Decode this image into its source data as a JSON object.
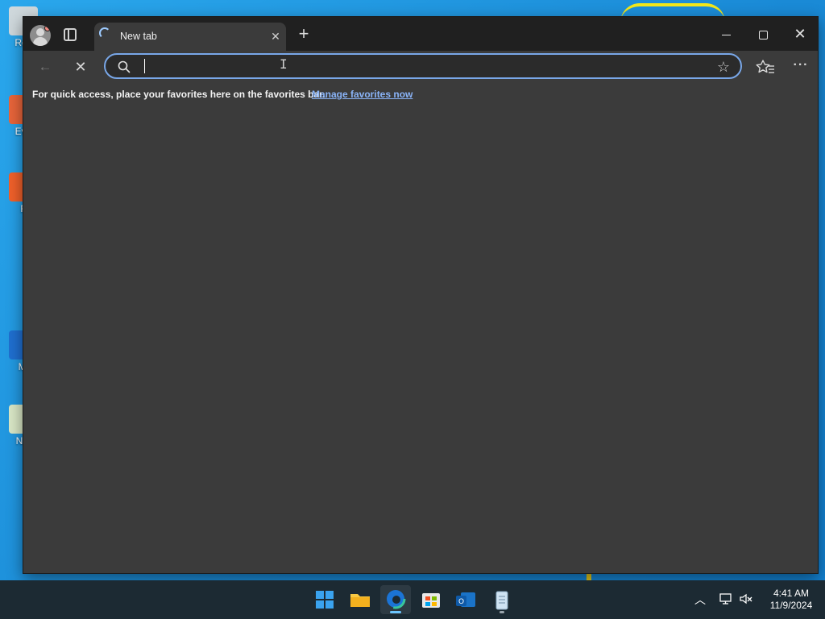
{
  "desktop": {
    "icons": [
      {
        "label": "Rec"
      },
      {
        "label": "Eve"
      },
      {
        "label": "F"
      },
      {
        "label": "Mi"
      },
      {
        "label": "Not"
      }
    ]
  },
  "browser": {
    "tab": {
      "title": "New tab"
    },
    "address_bar": {
      "value": "",
      "placeholder": ""
    },
    "favorites_bar": {
      "hint": "For quick access, place your favorites here on the favorites bar.",
      "link": "Manage favorites now"
    },
    "icons": {
      "profile": "profile-icon",
      "tab_actions": "tab-actions-icon",
      "new_tab": "plus-icon",
      "back": "back-arrow-icon",
      "stop": "stop-loading-icon",
      "search": "search-icon",
      "favorite": "star-icon",
      "favorites": "favorites-icon",
      "more": "more-icon"
    },
    "accent_color": "#79a7e8",
    "link_color": "#8ab4f8"
  },
  "taskbar": {
    "apps": [
      "Start",
      "File Explorer",
      "Microsoft Edge",
      "Microsoft Store",
      "Outlook (new)",
      "Notepad"
    ],
    "clock": {
      "time": "4:41 AM",
      "date": "11/9/2024"
    }
  }
}
